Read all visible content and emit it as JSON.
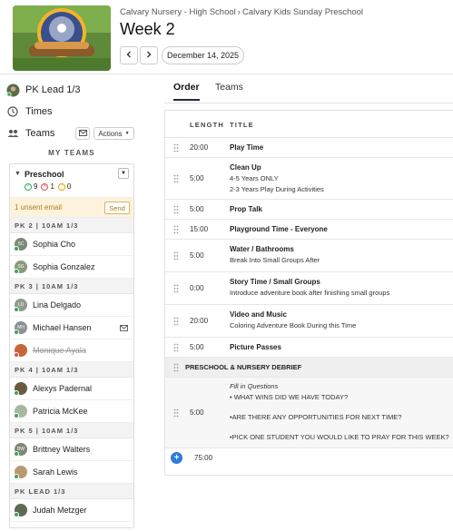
{
  "header": {
    "breadcrumb": [
      "Calvary Nursery - High School",
      "Calvary Kids Sunday Preschool"
    ],
    "breadcrumb_sep": "›",
    "title": "Week 2",
    "date": "December 14, 2025",
    "prev_icon": "chevron-left-icon",
    "next_icon": "chevron-right-icon"
  },
  "sidebar": {
    "position": "PK Lead 1/3",
    "times_label": "Times",
    "teams_label": "Teams",
    "actions_label": "Actions",
    "my_teams_label": "MY TEAMS",
    "team": {
      "name": "Preschool",
      "confirmed": "9",
      "declined": "1",
      "pending": "0"
    },
    "unsent": {
      "text": "1 unsent email",
      "send_label": "Send"
    },
    "groups": [
      {
        "label": "PK 2 | 10AM 1/3",
        "members": [
          {
            "name": "Sophia Cho",
            "initials": "SC",
            "color": "#7a8a76"
          },
          {
            "name": "Sophia Gonzalez",
            "initials": "SG",
            "color": "#8b9a7e"
          }
        ]
      },
      {
        "label": "PK 3 | 10AM 1/3",
        "members": [
          {
            "name": "Lina Delgado",
            "initials": "LD",
            "color": "#8f9c8a"
          },
          {
            "name": "Michael Hansen",
            "initials": "MH",
            "color": "#8d8f94"
          },
          {
            "name": "Monique Ayala",
            "initials": "",
            "color": "#c9643a"
          }
        ]
      },
      {
        "label": "PK 4 | 10AM 1/3",
        "members": [
          {
            "name": "Alexys Padernal",
            "initials": "",
            "color": "#6b5a3e"
          },
          {
            "name": "Patricia McKee",
            "initials": "",
            "color": "#a8b8a0"
          }
        ]
      },
      {
        "label": "PK 5 | 10AM 1/3",
        "members": [
          {
            "name": "Brittney Walters",
            "initials": "BW",
            "color": "#7d8a74"
          },
          {
            "name": "Sarah Lewis",
            "initials": "",
            "color": "#b79a72"
          }
        ]
      },
      {
        "label": "PK LEAD 1/3",
        "members": [
          {
            "name": "Judah Metzger",
            "initials": "",
            "color": "#5e6b55"
          }
        ]
      }
    ]
  },
  "tabs": {
    "order": "Order",
    "teams": "Teams"
  },
  "order": {
    "col_length": "LENGTH",
    "col_title": "TITLE",
    "items": [
      {
        "length": "20:00",
        "title": "Play Time",
        "subs": []
      },
      {
        "length": "5:00",
        "title": "Clean Up",
        "subs": [
          "4-5 Years ONLY",
          "2-3 Years Play During Activities"
        ]
      },
      {
        "length": "5:00",
        "title": "Prop Talk",
        "subs": []
      },
      {
        "length": "15:00",
        "title": "Playground Time - Everyone",
        "subs": []
      },
      {
        "length": "5:00",
        "title": "Water / Bathrooms",
        "subs": [
          "Break Into Small Groups After"
        ]
      },
      {
        "length": "0:00",
        "title": "Story Time / Small Groups",
        "subs": [
          "Introduce adventure book after finishing small groups"
        ]
      },
      {
        "length": "20:00",
        "title": "Video and Music",
        "subs": [
          "Coloring Adventure Book During this Time"
        ]
      },
      {
        "length": "5:00",
        "title": "Picture Passes",
        "subs": []
      }
    ],
    "section": "PRESCHOOL & NURSERY DEBRIEF",
    "debrief": {
      "length": "5:00",
      "heading": "Fill in Questions",
      "lines": [
        "• WHAT WINS DID WE HAVE TODAY?",
        "•ARE THERE ANY OPPORTUNITIES FOR NEXT TIME?",
        "•PICK ONE STUDENT YOU WOULD LIKE TO PRAY FOR THIS WEEK?"
      ]
    },
    "total": "75:00"
  },
  "colors": {
    "accent": "#2e7bd6",
    "confirmed": "#3aa655",
    "declined": "#d9534f",
    "pending": "#e0a800"
  }
}
